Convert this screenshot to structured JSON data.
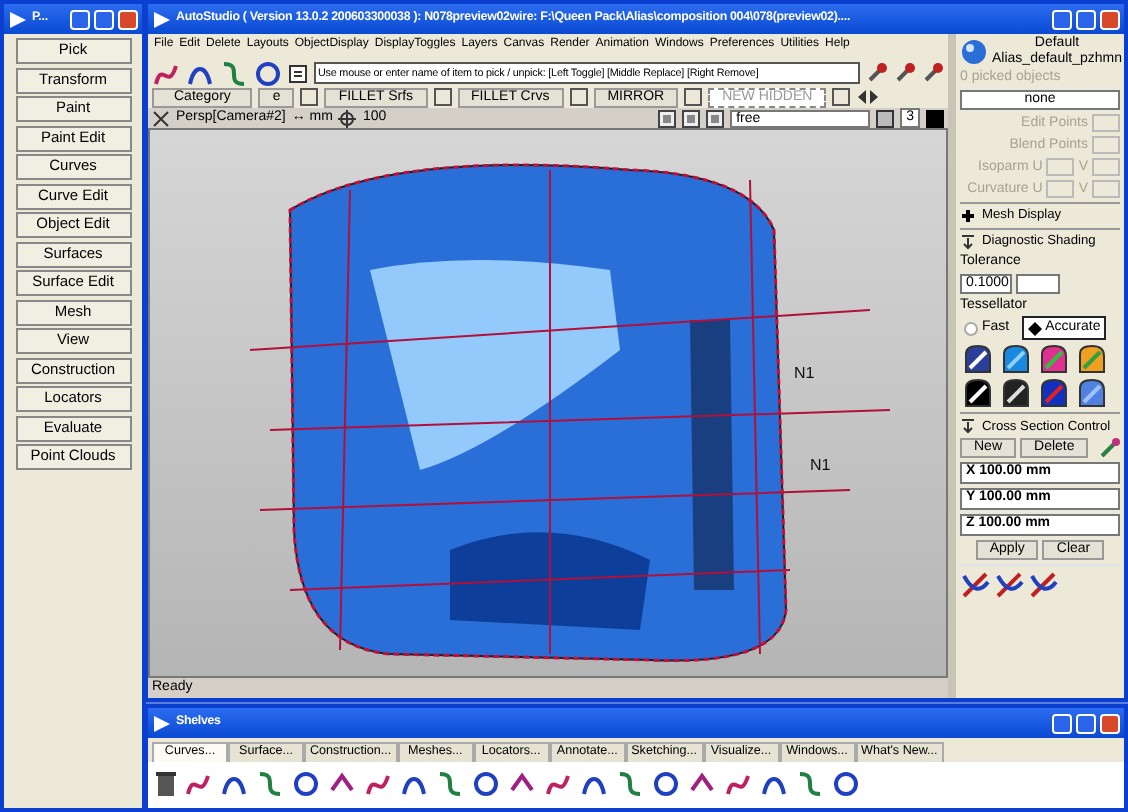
{
  "palette": {
    "title": "P...",
    "buttons": [
      "Pick",
      "Transform",
      "Paint",
      "Paint Edit",
      "Curves",
      "Curve Edit",
      "Object Edit",
      "Surfaces",
      "Surface Edit",
      "Mesh",
      "View",
      "Construction",
      "Locators",
      "Evaluate",
      "Point Clouds"
    ]
  },
  "main": {
    "title": "AutoStudio ( Version 13.0.2  200603300038 ): N078preview02wire: F:\\Queen Pack\\Alias\\composition 004\\078(preview02)....",
    "menu": [
      "File",
      "Edit",
      "Delete",
      "Layouts",
      "ObjectDisplay",
      "DisplayToggles",
      "Layers",
      "Canvas",
      "Render",
      "Animation",
      "Windows",
      "Preferences",
      "Utilities",
      "Help"
    ],
    "prompt": {
      "value": "Use mouse or enter name of item to pick / unpick: [Left Toggle] [Middle Replace] [Right Remove]"
    },
    "shelf_bar": {
      "category": "Category",
      "items": [
        {
          "label": "e",
          "kind": "plain",
          "checked": false
        },
        {
          "label": "FILLET Srfs",
          "kind": "plain",
          "checked": false
        },
        {
          "label": "FILLET Crvs",
          "kind": "plain",
          "checked": false
        },
        {
          "label": "MIRROR",
          "kind": "plain",
          "checked": false
        },
        {
          "label": "NEW HIDDEN",
          "kind": "dashed",
          "checked": false
        }
      ]
    },
    "viewport": {
      "camera": "Persp[Camera#2]",
      "units": "↔ mm",
      "scale": "100",
      "mode": "free",
      "count": "3",
      "labels": [
        "N1",
        "N1"
      ]
    },
    "status": "Ready"
  },
  "control_panel": {
    "layer": "Default",
    "shader": "Alias_default_pzhmn",
    "picked": "0 picked objects",
    "selection": "none",
    "fields": [
      {
        "label": "Edit Points",
        "kind": "single",
        "disabled": true
      },
      {
        "label": "Blend Points",
        "kind": "single",
        "disabled": true
      },
      {
        "label": "Isoparm U",
        "second": "V",
        "kind": "pair",
        "disabled": true
      },
      {
        "label": "Curvature U",
        "second": "V",
        "kind": "pair",
        "disabled": true
      }
    ],
    "mesh_display": {
      "title": "Mesh Display",
      "expanded": false
    },
    "diagnostic": {
      "title": "Diagnostic Shading",
      "expanded": true,
      "tolerance_label": "Tolerance",
      "tolerance": "0.1000",
      "tessellator_label": "Tessellator",
      "options": [
        {
          "label": "Fast",
          "selected": false
        },
        {
          "label": "Accurate",
          "selected": true
        }
      ]
    },
    "cross_section": {
      "title": "Cross Section Control",
      "expanded": true,
      "new": "New",
      "delete": "Delete",
      "rows": [
        "X 100.00 mm",
        "Y 100.00 mm",
        "Z 100.00 mm"
      ],
      "apply": "Apply",
      "clear": "Clear"
    }
  },
  "shelves": {
    "title": "Shelves",
    "tabs": [
      {
        "label": "Curves...",
        "selected": true
      },
      {
        "label": "Surface...",
        "selected": false
      },
      {
        "label": "Construction...",
        "selected": false
      },
      {
        "label": "Meshes...",
        "selected": false
      },
      {
        "label": "Locators...",
        "selected": false
      },
      {
        "label": "Annotate...",
        "selected": false
      },
      {
        "label": "Sketching...",
        "selected": false
      },
      {
        "label": "Visualize...",
        "selected": false
      },
      {
        "label": "Windows...",
        "selected": false
      },
      {
        "label": "What's New...",
        "selected": false
      }
    ]
  }
}
